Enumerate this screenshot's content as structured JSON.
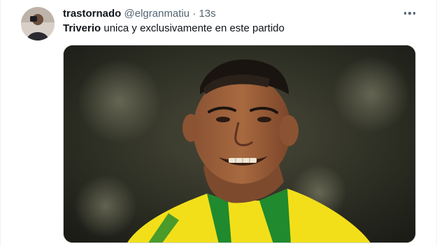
{
  "tweet": {
    "author_name": "trastornado",
    "handle": "@elgranmatiu",
    "separator": "·",
    "time": "13s",
    "mention": "Triverio",
    "text": " unica y exclusivamente en este partido"
  },
  "icons": {
    "more": "more-horizontal-icon"
  },
  "colors": {
    "text_primary": "#0f1419",
    "text_secondary": "#536471",
    "border": "#cfd9de",
    "jersey_yellow": "#f2df1a",
    "jersey_green": "#1f8a2e"
  }
}
